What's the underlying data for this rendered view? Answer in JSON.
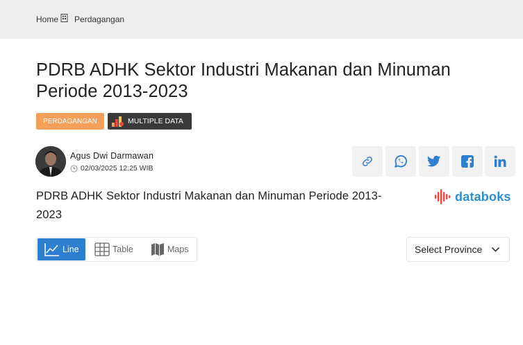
{
  "breadcrumb": {
    "home": "Home",
    "current": "Perdagangan"
  },
  "article": {
    "title": "PDRB ADHK Sektor Industri Makanan dan Minuman Periode 2013-2023",
    "category_tag": "PERDAGANGAN",
    "multi_tag": "MULTIPLE DATA"
  },
  "author": {
    "name": "Agus Dwi Darmawan",
    "date": "02/03/2025 12:25 WIB"
  },
  "share": [
    "link-icon",
    "whatsapp-icon",
    "twitter-icon",
    "facebook-icon",
    "linkedin-icon"
  ],
  "chart_header": {
    "title": "PDRB ADHK Sektor Industri Makanan dan Minuman Periode 2013-2023",
    "logo": "databoks"
  },
  "view_tabs": {
    "line": "Line",
    "table": "Table",
    "maps": "Maps",
    "active": "line"
  },
  "province_select": {
    "label": "Select Province"
  },
  "colors": {
    "accent": "#2f7fd0",
    "tag_orange": "#f5a05a",
    "tag_dark": "#3a3a3a",
    "logo_blue": "#2f8fd4",
    "logo_red": "#e8483f"
  }
}
